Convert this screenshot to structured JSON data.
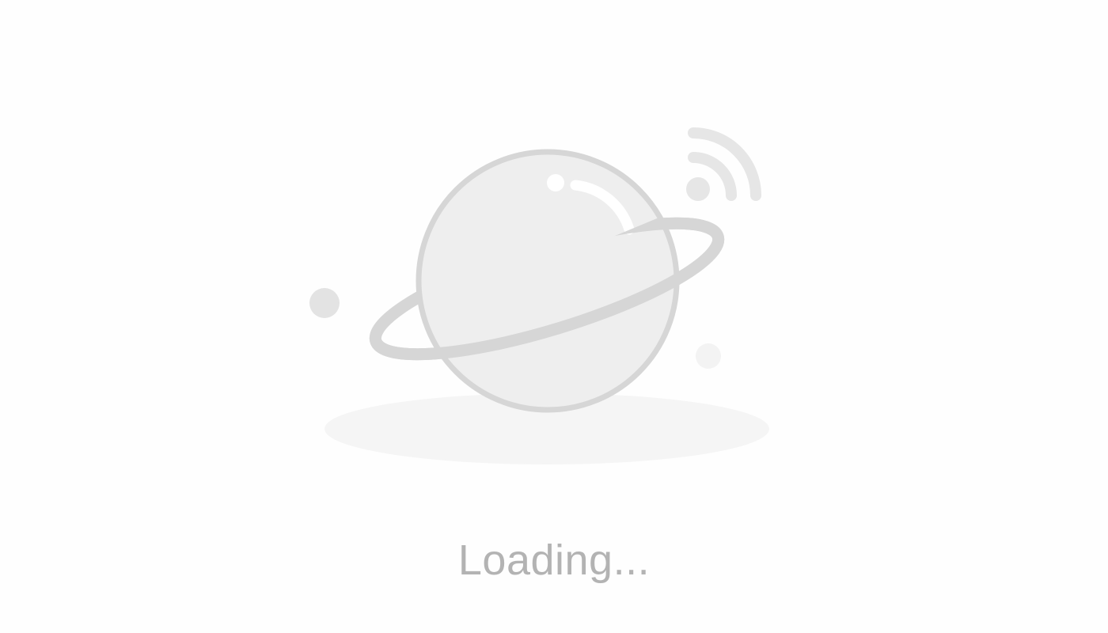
{
  "status": {
    "loading_text": "Loading..."
  },
  "illustration": {
    "icon": "planet-icon",
    "signal_icon": "wifi-signal-icon",
    "colors": {
      "background": "#fefefe",
      "planet_fill": "#eeeeee",
      "planet_outline": "#d6d6d6",
      "ring": "#d6d6d6",
      "shadow": "#f5f5f5",
      "highlight": "#ffffff",
      "signal": "#e6e6e6",
      "dot_dark": "#e3e3e3",
      "dot_light": "#f3f3f3",
      "text": "#b3b3b3"
    }
  }
}
